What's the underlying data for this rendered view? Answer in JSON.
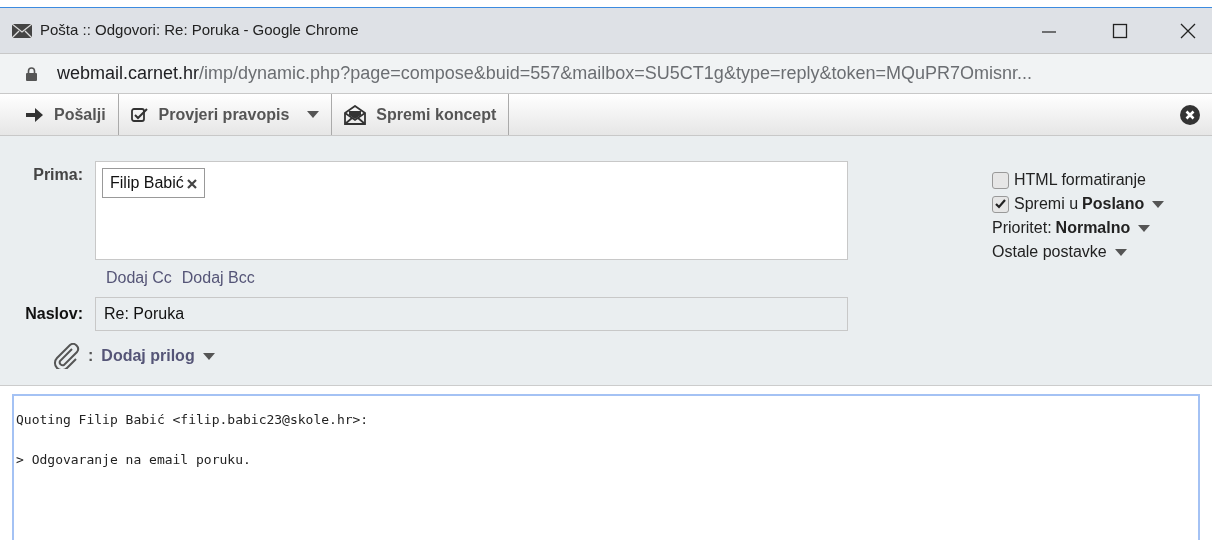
{
  "window": {
    "title": "Pošta :: Odgovori: Re: Poruka - Google Chrome"
  },
  "address_bar": {
    "domain": "webmail.carnet.hr",
    "path": "/imp/dynamic.php?page=compose&buid=557&mailbox=SU5CT1g&type=reply&token=MQuPR7Omisnr..."
  },
  "toolbar": [
    {
      "kind": "send",
      "label": "Pošalji",
      "dropdown": false
    },
    {
      "kind": "spell",
      "label": "Provjeri pravopis",
      "dropdown": true
    },
    {
      "kind": "draft",
      "label": "Spremi koncept",
      "dropdown": false
    }
  ],
  "recipients": {
    "label": "Prima:",
    "tokens": [
      "Filip Babić"
    ],
    "links": [
      "Dodaj Cc",
      "Dodaj Bcc"
    ]
  },
  "subject": {
    "label": "Naslov:",
    "value": "Re: Poruka"
  },
  "attachment": {
    "separator": ":",
    "label": "Dodaj prilog"
  },
  "options": [
    {
      "kind": "checkbox",
      "checked": false,
      "label": "HTML formatiranje",
      "dropdown": false
    },
    {
      "kind": "checkbox",
      "checked": true,
      "label": "Spremi u",
      "value": "Poslano",
      "dropdown": true
    },
    {
      "kind": "menu",
      "label": "Prioritet:",
      "value": "Normalno",
      "dropdown": true
    },
    {
      "kind": "menu",
      "label": "Ostale postavke",
      "dropdown": true
    }
  ],
  "body": {
    "lines": [
      "Quoting Filip Babić <filip.babic23@skole.hr>:",
      "> Odgovaranje na email poruku."
    ]
  }
}
